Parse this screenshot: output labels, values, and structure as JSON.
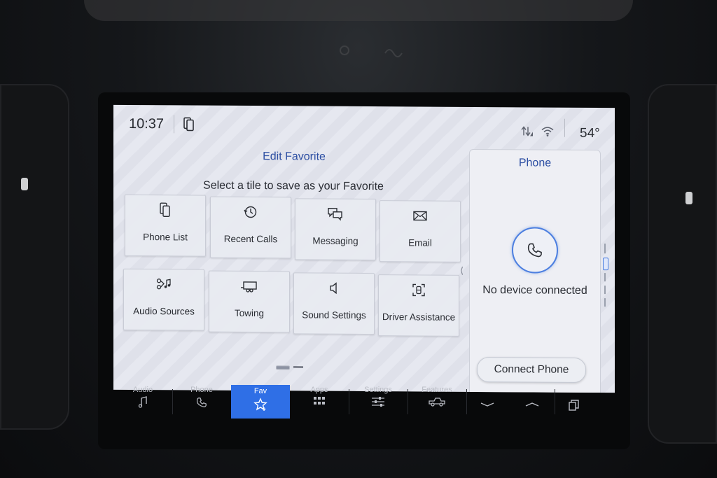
{
  "status": {
    "time": "10:37",
    "temperature": "54°"
  },
  "edit": {
    "title": "Edit Favorite",
    "subtitle": "Select a tile to save as your Favorite"
  },
  "tiles": [
    {
      "label": "Phone List",
      "icon": "phone-list-icon"
    },
    {
      "label": "Recent Calls",
      "icon": "recent-calls-icon"
    },
    {
      "label": "Messaging",
      "icon": "messaging-icon"
    },
    {
      "label": "Email",
      "icon": "email-icon"
    },
    {
      "label": "Audio Sources",
      "icon": "audio-sources-icon"
    },
    {
      "label": "Towing",
      "icon": "towing-icon"
    },
    {
      "label": "Sound Settings",
      "icon": "sound-settings-icon"
    },
    {
      "label": "Driver Assistance",
      "icon": "driver-assistance-icon"
    }
  ],
  "phone_panel": {
    "title": "Phone",
    "status": "No device connected",
    "button": "Connect Phone"
  },
  "nav": [
    {
      "label": "Audio",
      "icon": "music-note-icon"
    },
    {
      "label": "Phone",
      "icon": "phone-icon"
    },
    {
      "label": "Fav",
      "icon": "star-icon",
      "active": true
    },
    {
      "label": "Apps",
      "icon": "apps-grid-icon"
    },
    {
      "label": "Settings",
      "icon": "sliders-icon"
    },
    {
      "label": "Features",
      "icon": "truck-icon"
    }
  ],
  "colors": {
    "accent": "#2f6fe6",
    "title": "#2d4fa3"
  }
}
